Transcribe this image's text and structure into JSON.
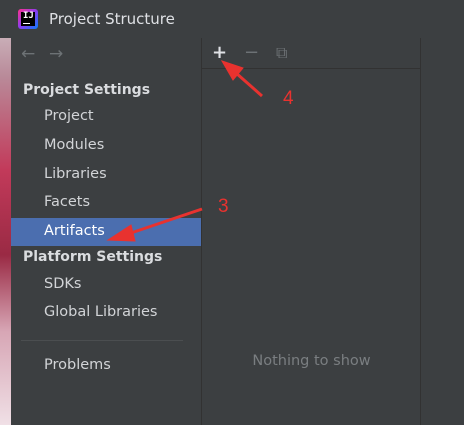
{
  "window": {
    "title": "Project Structure"
  },
  "icons": {
    "app": "intellij-idea-logo",
    "back": "back-arrow-icon",
    "forward": "forward-arrow-icon",
    "add": "plus-icon",
    "remove": "minus-icon",
    "copy": "copy-icon"
  },
  "toolbar": {
    "back": "←",
    "forward": "→",
    "add": "+",
    "remove": "−",
    "copy": "⧉"
  },
  "sidebar": {
    "project_settings_header": "Project Settings",
    "platform_settings_header": "Platform Settings",
    "items": {
      "project": "Project",
      "modules": "Modules",
      "libraries": "Libraries",
      "facets": "Facets",
      "artifacts": "Artifacts",
      "sdks": "SDKs",
      "global_libraries": "Global Libraries",
      "problems": "Problems"
    },
    "selected": "Artifacts"
  },
  "main": {
    "empty_text": "Nothing to show"
  },
  "annotations": {
    "step3": "3",
    "step4": "4",
    "color": "#e8322f"
  }
}
